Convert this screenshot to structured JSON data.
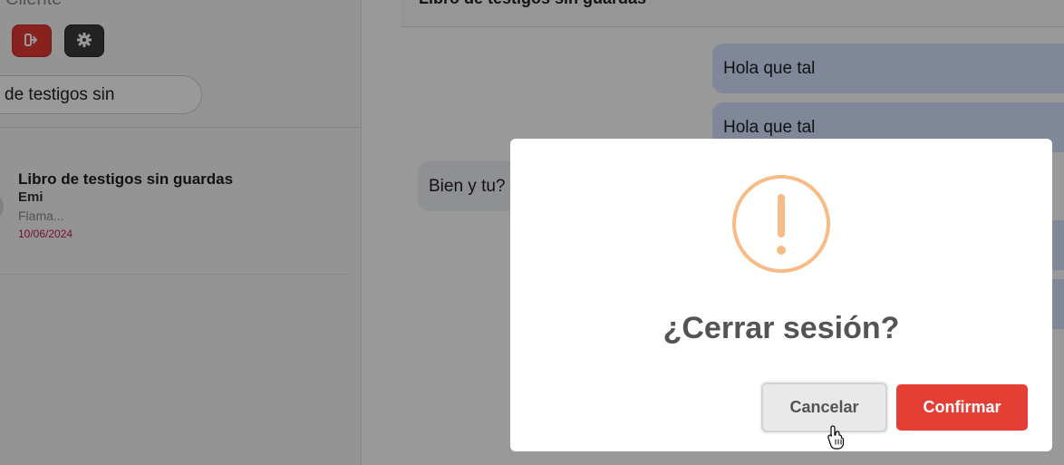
{
  "sidebar": {
    "user_name": "Cliente",
    "logout_icon": "sign-out-icon",
    "settings_icon": "gear-icon",
    "search_value": "de testigos sin",
    "chat_list": [
      {
        "title": "Libro de testigos sin guardas",
        "user": "Emi",
        "preview": "Flama...",
        "date": "10/06/2024"
      }
    ]
  },
  "chat": {
    "title": "Libro de testigos sin guardas",
    "messages": [
      {
        "direction": "out",
        "text": "Hola que tal"
      },
      {
        "direction": "out",
        "text": "Hola que tal"
      },
      {
        "direction": "in",
        "text": "Bien y tu?"
      }
    ]
  },
  "modal": {
    "icon": "exclamation-warning-icon",
    "title": "¿Cerrar sesión?",
    "cancel_label": "Cancelar",
    "confirm_label": "Confirmar"
  },
  "colors": {
    "danger": "#e53e35",
    "warning_icon": "#f8bb86",
    "outgoing_bubble": "#d4e2ff",
    "date_text": "#c2185b"
  }
}
